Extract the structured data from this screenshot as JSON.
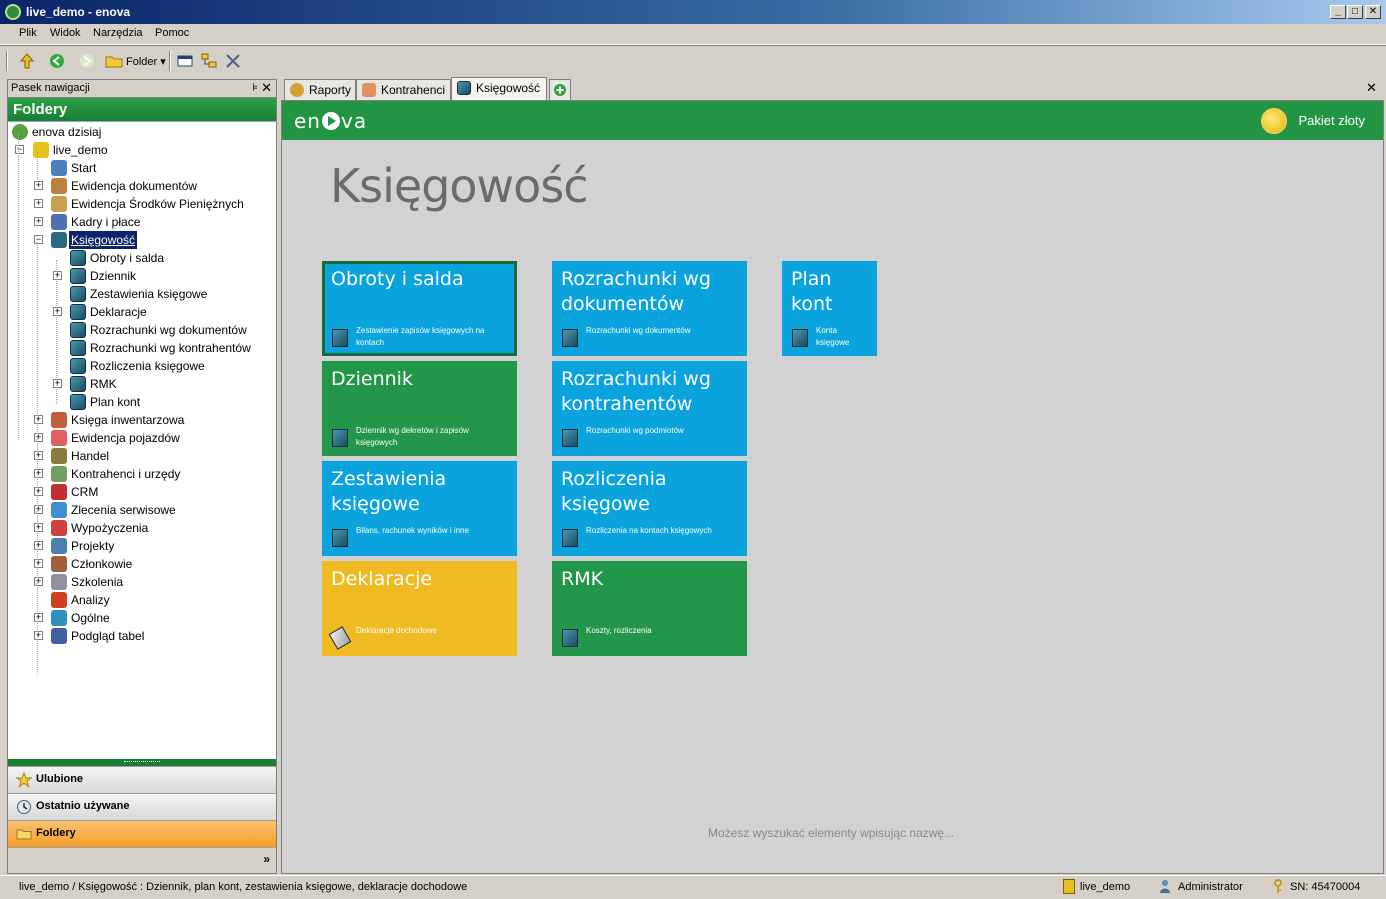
{
  "window": {
    "title": "live_demo - enova"
  },
  "menu": [
    "Plik",
    "Widok",
    "Narzędzia",
    "Pomoc"
  ],
  "toolbar": {
    "folder_label": "Folder"
  },
  "nav": {
    "header": "Pasek nawigacji",
    "pin": "⊧",
    "close": "✕",
    "section_title": "Foldery",
    "tree": [
      {
        "label": "enova dzisiaj",
        "level": 0
      },
      {
        "label": "live_demo",
        "level": 1,
        "toggle": "−"
      },
      {
        "label": "Start",
        "level": 2
      },
      {
        "label": "Ewidencja dokumentów",
        "level": 2,
        "toggle": "+"
      },
      {
        "label": "Ewidencja Środków Pieniężnych",
        "level": 2,
        "toggle": "+"
      },
      {
        "label": "Kadry i płace",
        "level": 2,
        "toggle": "+"
      },
      {
        "label": "Księgowość",
        "level": 2,
        "toggle": "−",
        "selected": true
      },
      {
        "label": "Obroty i salda",
        "level": 3
      },
      {
        "label": "Dziennik",
        "level": 3,
        "toggle": "+"
      },
      {
        "label": "Zestawienia księgowe",
        "level": 3
      },
      {
        "label": "Deklaracje",
        "level": 3,
        "toggle": "+"
      },
      {
        "label": "Rozrachunki wg dokumentów",
        "level": 3
      },
      {
        "label": "Rozrachunki wg kontrahentów",
        "level": 3
      },
      {
        "label": "Rozliczenia księgowe",
        "level": 3
      },
      {
        "label": "RMK",
        "level": 3,
        "toggle": "+"
      },
      {
        "label": "Plan kont",
        "level": 3
      },
      {
        "label": "Księga inwentarzowa",
        "level": 2,
        "toggle": "+"
      },
      {
        "label": "Ewidencja pojazdów",
        "level": 2,
        "toggle": "+"
      },
      {
        "label": "Handel",
        "level": 2,
        "toggle": "+"
      },
      {
        "label": "Kontrahenci i urzędy",
        "level": 2,
        "toggle": "+"
      },
      {
        "label": "CRM",
        "level": 2,
        "toggle": "+"
      },
      {
        "label": "Zlecenia serwisowe",
        "level": 2,
        "toggle": "+"
      },
      {
        "label": "Wypożyczenia",
        "level": 2,
        "toggle": "+"
      },
      {
        "label": "Projekty",
        "level": 2,
        "toggle": "+"
      },
      {
        "label": "Członkowie",
        "level": 2,
        "toggle": "+"
      },
      {
        "label": "Szkolenia",
        "level": 2,
        "toggle": "+"
      },
      {
        "label": "Analizy",
        "level": 2
      },
      {
        "label": "Ogólne",
        "level": 2,
        "toggle": "+"
      },
      {
        "label": "Podgląd tabel",
        "level": 2,
        "toggle": "+"
      }
    ],
    "buttons": {
      "favorites": "Ulubione",
      "recent": "Ostatnio używane",
      "folders": "Foldery"
    },
    "footer_chevron": "»"
  },
  "tabs": [
    "Raporty",
    "Kontrahenci",
    "Księgowość"
  ],
  "tab_close": "✕",
  "content": {
    "brand": {
      "before": "en",
      "after": "va"
    },
    "package": "Pakiet złoty",
    "page_title": "Księgowość",
    "tiles": [
      {
        "title": "Obroty i salda",
        "subtitle": "Zestawienie zapisów księgowych na kontach",
        "color": "blue",
        "selected": true
      },
      {
        "title": "Dziennik",
        "subtitle": "Dziennik wg dekretów i zapisów księgowych",
        "color": "green"
      },
      {
        "title": "Zestawienia księgowe",
        "subtitle": "Bilans, rachunek wyników i inne",
        "color": "blue"
      },
      {
        "title": "Deklaracje",
        "subtitle": "Deklaracje dochodowe",
        "color": "yellow"
      },
      {
        "title": "Rozrachunki wg dokumentów",
        "subtitle": "Rozrachunki wg dokumentów",
        "color": "blue"
      },
      {
        "title": "Rozrachunki wg kontrahentów",
        "subtitle": "Rozrachunki wg podmiotów",
        "color": "blue"
      },
      {
        "title": "Rozliczenia księgowe",
        "subtitle": "Rozliczenia na kontach księgowych",
        "color": "blue"
      },
      {
        "title": "RMK",
        "subtitle": "Koszty, rozliczenia",
        "color": "green"
      },
      {
        "title": "Plan kont",
        "subtitle": "Konta księgowe",
        "color": "blue"
      }
    ],
    "search_hint": "Możesz wyszukać elementy wpisując nazwę..."
  },
  "status": {
    "path": "live_demo / Księgowość : Dziennik, plan kont, zestawienia księgowe, deklaracje dochodowe",
    "database": "live_demo",
    "user": "Administrator",
    "serial": "SN: 45470004"
  }
}
